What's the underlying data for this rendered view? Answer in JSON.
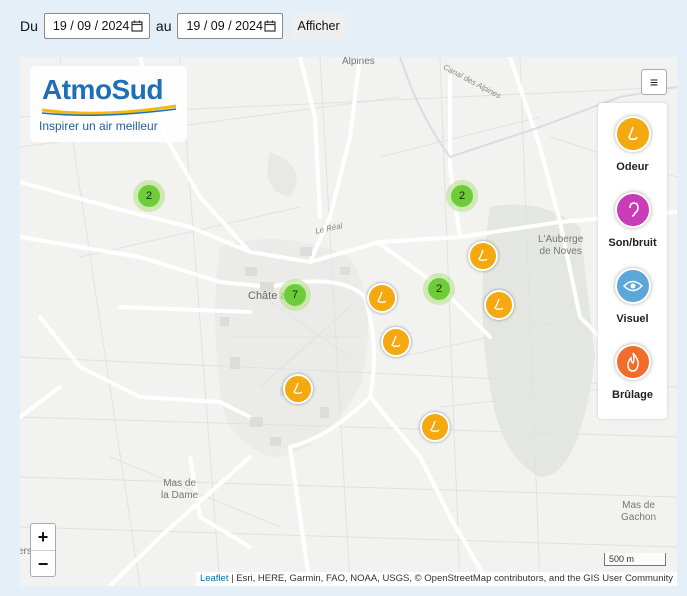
{
  "filter": {
    "from_label": "Du",
    "from_date": "19 / 09 / 2024",
    "to_label": "au",
    "to_date": "19 / 09 / 2024",
    "submit_label": "Afficher"
  },
  "logo": {
    "title": "AtmoSud",
    "tagline": "Inspirer un air meilleur"
  },
  "layers_icon": "≡",
  "legend": {
    "items": [
      {
        "label": "Odeur",
        "color": "#f5a911",
        "icon": "nose-icon"
      },
      {
        "label": "Son/bruit",
        "color": "#c93bb7",
        "icon": "ear-icon"
      },
      {
        "label": "Visuel",
        "color": "#5ba8d8",
        "icon": "eye-icon"
      },
      {
        "label": "Brûlage",
        "color": "#f26d2c",
        "icon": "flame-icon"
      }
    ]
  },
  "places": {
    "alpines": "Alpines",
    "canal": "Canal des Alpines",
    "chateau": "Châte     ard",
    "auberge_line1": "L'Auberge",
    "auberge_line2": "de Noves",
    "mas_dame_line1": "Mas de",
    "mas_dame_line2": "la Dame",
    "mas_gachon_line1": "Mas de",
    "mas_gachon_line2": "Gachon",
    "edge": "ers",
    "le_real": "Le Réal"
  },
  "clusters": [
    {
      "count": "2"
    },
    {
      "count": "2"
    },
    {
      "count": "7"
    },
    {
      "count": "2"
    }
  ],
  "zoom": {
    "in": "+",
    "out": "−"
  },
  "scale": "500 m",
  "attribution": {
    "leaflet": "Leaflet",
    "rest": " | Esri, HERE, Garmin, FAO, NOAA, USGS, © OpenStreetMap contributors, and the GIS User Community"
  }
}
